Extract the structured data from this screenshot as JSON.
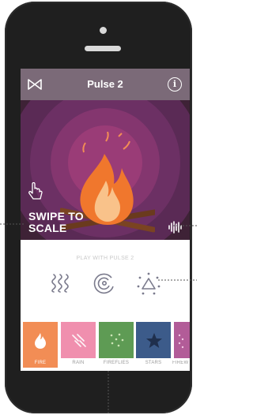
{
  "header": {
    "title": "Pulse 2"
  },
  "scene": {
    "hint_line1": "SWIPE TO",
    "hint_line2": "SCALE"
  },
  "controls": {
    "play_with": "PLAY WITH PULSE 2"
  },
  "tiles": [
    {
      "label": "FIRE",
      "color": "#f28d55",
      "icon": "flame-icon",
      "active": true
    },
    {
      "label": "RAIN",
      "color": "#f08fae",
      "icon": "rain-icon",
      "active": false
    },
    {
      "label": "FIREFLIES",
      "color": "#5e9b54",
      "icon": "fireflies-icon",
      "active": false
    },
    {
      "label": "STARS",
      "color": "#3c5b8a",
      "icon": "star-icon",
      "active": false
    },
    {
      "label": "FIREW",
      "color": "#b25c98",
      "icon": "fireworks-icon",
      "active": false
    }
  ],
  "colors": {
    "header_bg": "#7b6a78",
    "scene_bg": "#3e2236",
    "accent": "#f28d55"
  }
}
